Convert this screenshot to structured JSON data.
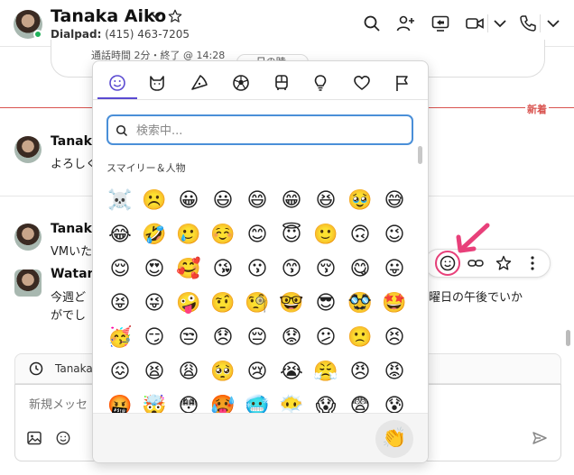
{
  "header": {
    "contact_name": "Tanaka Aiko",
    "line_label": "Dialpad:",
    "phone": "(415) 463-7205"
  },
  "chat": {
    "call_summary": "通話時間 2分・終了 @ 14:28",
    "call_pill": "ー日の時 ー",
    "new_marker": "新着",
    "messages": [
      {
        "name": "Tanaka",
        "text": "よろしく"
      },
      {
        "name": "Tanaka",
        "text": "VMいた"
      },
      {
        "name": "Watan",
        "text": "今週ど",
        "text_right": "曜日の午後でいか",
        "text2": "がでし"
      }
    ]
  },
  "composer": {
    "thread_label": "Tanaka",
    "placeholder": "新規メッセ"
  },
  "emoji_picker": {
    "active_tab": "smileys",
    "tabs": [
      "smiley-icon",
      "cat-icon",
      "pizza-icon",
      "ball-icon",
      "bus-icon",
      "bulb-icon",
      "heart-icon",
      "flag-icon"
    ],
    "search_placeholder": "検索中...",
    "section_label": "スマイリー＆人物",
    "emojis": [
      "☠️",
      "☹️",
      "😀",
      "😃",
      "😄",
      "😁",
      "😆",
      "🥹",
      "😅",
      "😂",
      "🤣",
      "🥲",
      "☺️",
      "😊",
      "😇",
      "🙂",
      "🙃",
      "😉",
      "😌",
      "😍",
      "🥰",
      "😘",
      "😗",
      "😙",
      "😚",
      "😋",
      "😛",
      "😝",
      "😜",
      "🤪",
      "🤨",
      "🧐",
      "🤓",
      "😎",
      "🥸",
      "🤩",
      "🥳",
      "😏",
      "😒",
      "😞",
      "😔",
      "😟",
      "😕",
      "🙁",
      "😣",
      "😖",
      "😫",
      "😩",
      "🥺",
      "😢",
      "😭",
      "😤",
      "😠",
      "😡",
      "🤬",
      "🤯",
      "😳",
      "🥵",
      "🥶",
      "😶‍🌫️",
      "😱",
      "😨",
      "😰"
    ],
    "skin_tone_emoji": "👏"
  },
  "colors": {
    "accent": "#5a4ad1",
    "search_border": "#4a8fd8",
    "new_marker": "#d9534f",
    "highlight": "#e8407a",
    "online": "#20b15a"
  }
}
